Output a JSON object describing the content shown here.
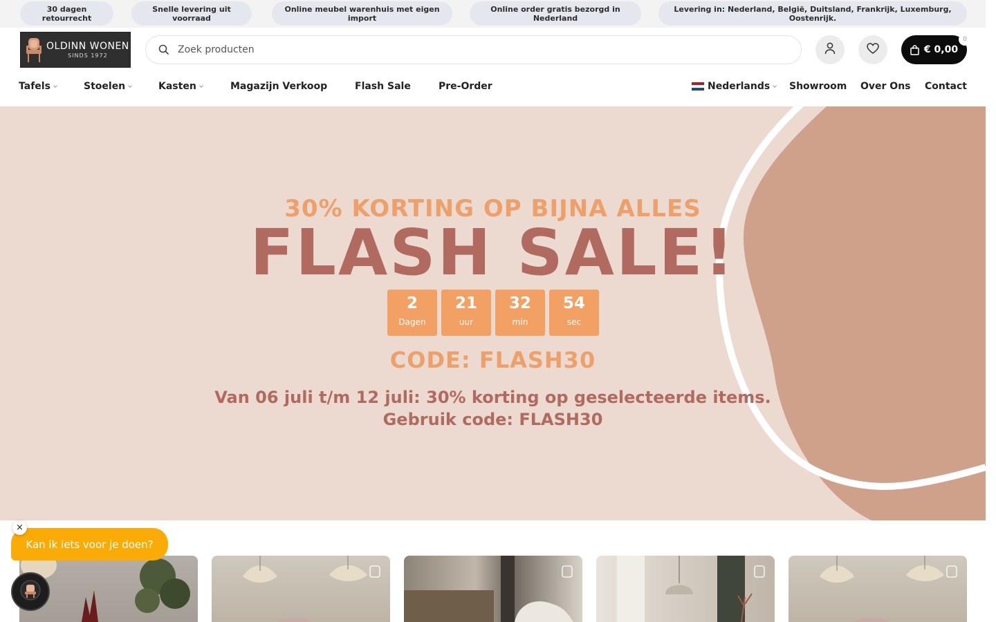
{
  "topbar": {
    "items": [
      "30 dagen retourrecht",
      "Snelle levering uit voorraad",
      "Online meubel warenhuis met eigen import",
      "Online order gratis bezorgd in Nederland",
      "Levering in: Nederland, België, Duitsland, Frankrijk, Luxemburg, Oostenrijk."
    ]
  },
  "header": {
    "logo_name": "OLDINN WONEN",
    "logo_tagline": "SINDS 1972",
    "search_placeholder": "Zoek producten",
    "cart_total": "€ 0,00",
    "cart_count": "0"
  },
  "nav": {
    "left": [
      "Tafels",
      "Stoelen",
      "Kasten",
      "Magazijn Verkoop",
      "Flash Sale",
      "Pre-Order"
    ],
    "language": "Nederlands",
    "right": [
      "Showroom",
      "Over Ons",
      "Contact"
    ]
  },
  "hero": {
    "subtitle": "30% KORTING OP BIJNA ALLES",
    "title": "FLASH SALE!",
    "countdown": [
      {
        "value": "2",
        "unit": "Dagen"
      },
      {
        "value": "21",
        "unit": "uur"
      },
      {
        "value": "32",
        "unit": "min"
      },
      {
        "value": "54",
        "unit": "sec"
      }
    ],
    "code": "CODE: FLASH30",
    "text_line1": "Van 06 juli t/m 12 juli: 30% korting op geselecteerde items.",
    "text_line2": "Gebruik code: FLASH30"
  },
  "chat": {
    "close": "×",
    "message": "Kan ik iets voor je doen?"
  },
  "colors": {
    "hero_bg": "#ecd9d0",
    "accent_orange": "#f2a063",
    "accent_rose": "#b06a5f",
    "chat": "#fbab05",
    "cart": "#0c0c0c"
  },
  "icons": {
    "search": "search-icon",
    "account": "user-icon",
    "wishlist": "heart-icon",
    "cart": "bag-icon"
  }
}
